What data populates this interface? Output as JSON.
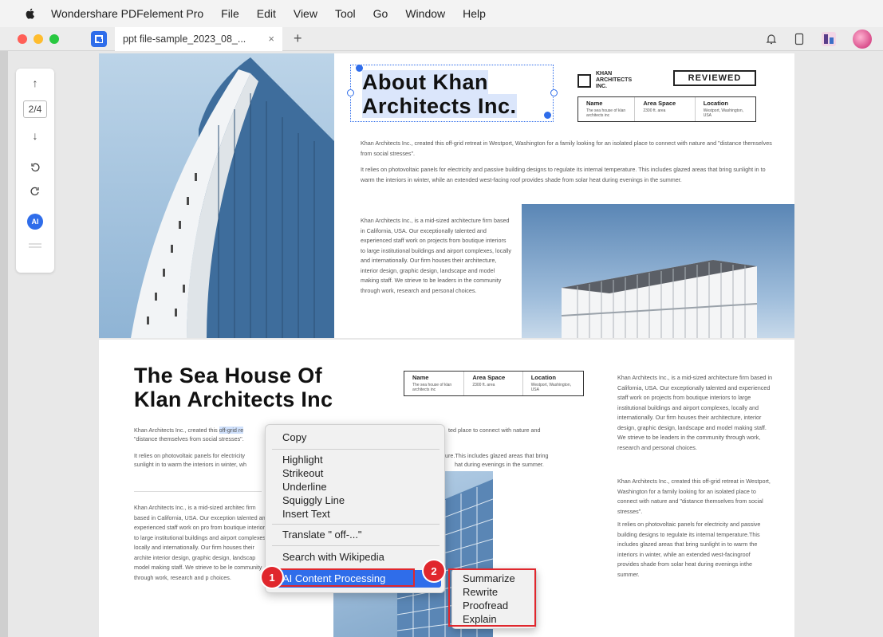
{
  "menubar": {
    "items": [
      "Wondershare PDFelement Pro",
      "File",
      "Edit",
      "View",
      "Tool",
      "Go",
      "Window",
      "Help"
    ]
  },
  "tabbar": {
    "tab_title": "ppt file-sample_2023_08_...",
    "close": "×",
    "plus": "+"
  },
  "toolbar": {
    "up": "↑",
    "page_indicator": "2/4",
    "down": "↓",
    "ai": "AI"
  },
  "page1": {
    "title_line1": "About Khan",
    "title_line2": "Architects Inc.",
    "logo_text": "KHAN ARCHITECTS INC.",
    "reviewed": "REVIEWED",
    "table": {
      "headers": [
        "Name",
        "Area Space",
        "Location"
      ],
      "values": [
        "The sea house of klan architects inc",
        "2300 ft. area",
        "Westport, Washington, USA"
      ]
    },
    "para1": "Khan Architects Inc., created this off-grid retreat in Westport, Washington for a family looking for an isolated place to connect with nature and \"distance themselves from social stresses\".",
    "para2": "It relies on photovoltaic panels for electricity and passive building designs to regulate its internal temperature. This includes glazed areas that bring sunlight in to warm the interiors in winter, while an extended west-facing roof provides shade from solar heat during evenings in the summer.",
    "para3": "Khan Architects Inc., is a mid-sized architecture firm based in California, USA. Our exceptionally talented and experienced staff work on projects from boutique interiors to large institutional buildings and airport complexes, locally and internationally. Our firm houses their architecture, interior design, graphic design, landscape and model making staff. We strieve to be leaders in the community through work, research and personal choices."
  },
  "page2": {
    "title_line1": "The Sea House Of",
    "title_line2": "Klan Architects Inc",
    "table": {
      "headers": [
        "Name",
        "Area Space",
        "Location"
      ],
      "values": [
        "The sea house of klan architects inc",
        "2300 ft. area",
        "Westport, Washington, USA"
      ]
    },
    "para1_a": "Khan Architects Inc., created this ",
    "para1_hl": "off-grid re",
    "para1_b": "ted place to connect with nature and",
    "para1_c": "\"distance themselves from social stresses\".",
    "para2_a": "It relies on photovoltaic panels for electricity",
    "para2_b": "sunlight in to warm the interiors in winter, wh",
    "para2_c": "ture.This includes glazed areas that bring",
    "para2_d": "hat during evenings in the summer.",
    "para3": "Khan Architects Inc., is a mid-sized architec firm based in California, USA. Our exception talented and experienced staff work on pro from boutique interiors to large institutional buildings and airport complexes, locally and internationally. Our firm houses their archite interior design, graphic design, landscap model making staff. We strieve to be le community through work, research and p choices.",
    "right1": "Khan Architects Inc., is a mid-sized architecture firm based in California, USA. Our exceptionally talented and experienced staff work on projects from boutique interiors to large institutional buildings and airport complexes, locally and internationally. Our firm houses their architecture, interior design, graphic design, landscape and model making staff. We strieve to be leaders in the community through work, research and personal choices.",
    "right2": "Khan Architects Inc., created this off-grid retreat in Westport, Washington for a family looking for an isolated place to connect with nature and \"distance themselves from social stresses\".",
    "right3": "It relies on photovoltaic panels for electricity and passive building designs to regulate its internal temperature.This includes glazed areas that bring sunlight in to warm the interiors in winter, while an extended west-facingroof provides shade from solar heat during evenings inthe summer."
  },
  "context_menu": {
    "copy": "Copy",
    "highlight": "Highlight",
    "strikeout": "Strikeout",
    "underline": "Underline",
    "squiggly": "Squiggly Line",
    "insert_text": "Insert Text",
    "translate": "Translate \" off-...\"",
    "wikipedia": "Search with Wikipedia",
    "ai_processing": "AI Content Processing",
    "badge1": "1"
  },
  "submenu": {
    "summarize": "Summarize",
    "rewrite": "Rewrite",
    "proofread": "Proofread",
    "explain": "Explain",
    "badge2": "2"
  },
  "colors": {
    "accent": "#2f6dea",
    "annotation_red": "#e0272d"
  }
}
